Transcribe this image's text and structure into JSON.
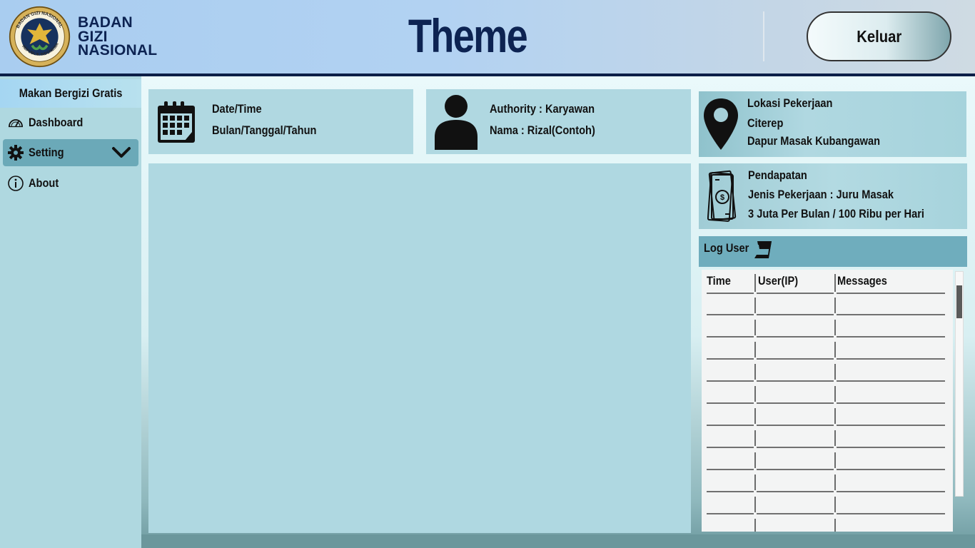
{
  "header": {
    "logo_seal_text": "BADAN GIZI NASIONAL · REPUBLIK INDONESIA",
    "logo_lines": [
      "BADAN",
      "GIZI",
      "NASIONAL"
    ],
    "title": "Theme",
    "logout_label": "Keluar"
  },
  "sidebar": {
    "title": "Makan Bergizi Gratis",
    "items": [
      {
        "label": "Dashboard",
        "icon": "gauge-icon",
        "active": false
      },
      {
        "label": "Setting",
        "icon": "gear-icon",
        "active": true,
        "expandable": true
      },
      {
        "label": "About",
        "icon": "info-icon",
        "active": false
      }
    ]
  },
  "datetime_card": {
    "icon": "calendar-icon",
    "label": "Date/Time",
    "value": "Bulan/Tanggal/Tahun"
  },
  "user_card": {
    "icon": "user-icon",
    "authority": "Authority : Karyawan",
    "name": "Nama : Rizal(Contoh)"
  },
  "location_card": {
    "icon": "location-pin-icon",
    "title": "Lokasi Pekerjaan",
    "city": "Citerep",
    "place": "Dapur Masak Kubangawan"
  },
  "income_card": {
    "icon": "money-icon",
    "title": "Pendapatan",
    "job": "Jenis Pekerjaan : Juru Masak",
    "salary": "3 Juta Per Bulan / 100 Ribu per Hari"
  },
  "log": {
    "title": "Log User",
    "icon": "scroll-icon",
    "columns": [
      "Time",
      "User(IP)",
      "Messages"
    ],
    "rows": [
      [
        "",
        "",
        ""
      ],
      [
        "",
        "",
        ""
      ],
      [
        "",
        "",
        ""
      ],
      [
        "",
        "",
        ""
      ],
      [
        "",
        "",
        ""
      ],
      [
        "",
        "",
        ""
      ],
      [
        "",
        "",
        ""
      ],
      [
        "",
        "",
        ""
      ],
      [
        "",
        "",
        ""
      ],
      [
        "",
        "",
        ""
      ],
      [
        "",
        "",
        ""
      ]
    ]
  },
  "colors": {
    "navy": "#0d2352",
    "sidebar": "#afd8e0",
    "card": "#b0d8e1",
    "active_nav": "#6ba9b8",
    "log_header": "#6fadbd"
  }
}
